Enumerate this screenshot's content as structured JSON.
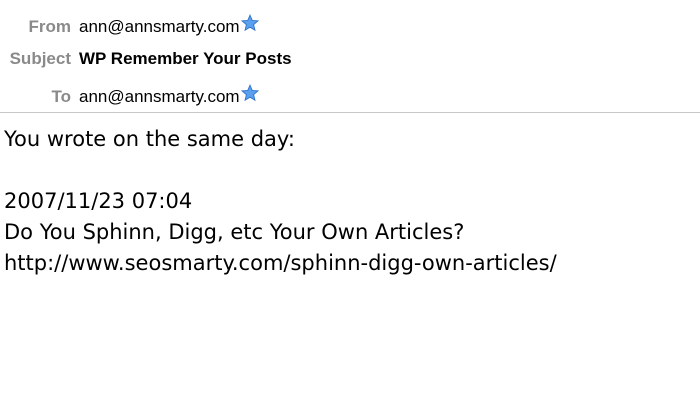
{
  "header": {
    "from_label": "From",
    "from_value": "ann@annsmarty.com",
    "subject_label": "Subject",
    "subject_value": "WP Remember Your Posts",
    "to_label": "To",
    "to_value": "ann@annsmarty.com",
    "vip_icon": "star-icon",
    "star_color": "#4a90e2"
  },
  "body": {
    "intro": "You wrote on the same day:",
    "date": "2007/11/23 07:04",
    "title": "Do You Sphinn, Digg, etc Your Own Articles?",
    "url": "http://www.seosmarty.com/sphinn-digg-own-articles/"
  }
}
